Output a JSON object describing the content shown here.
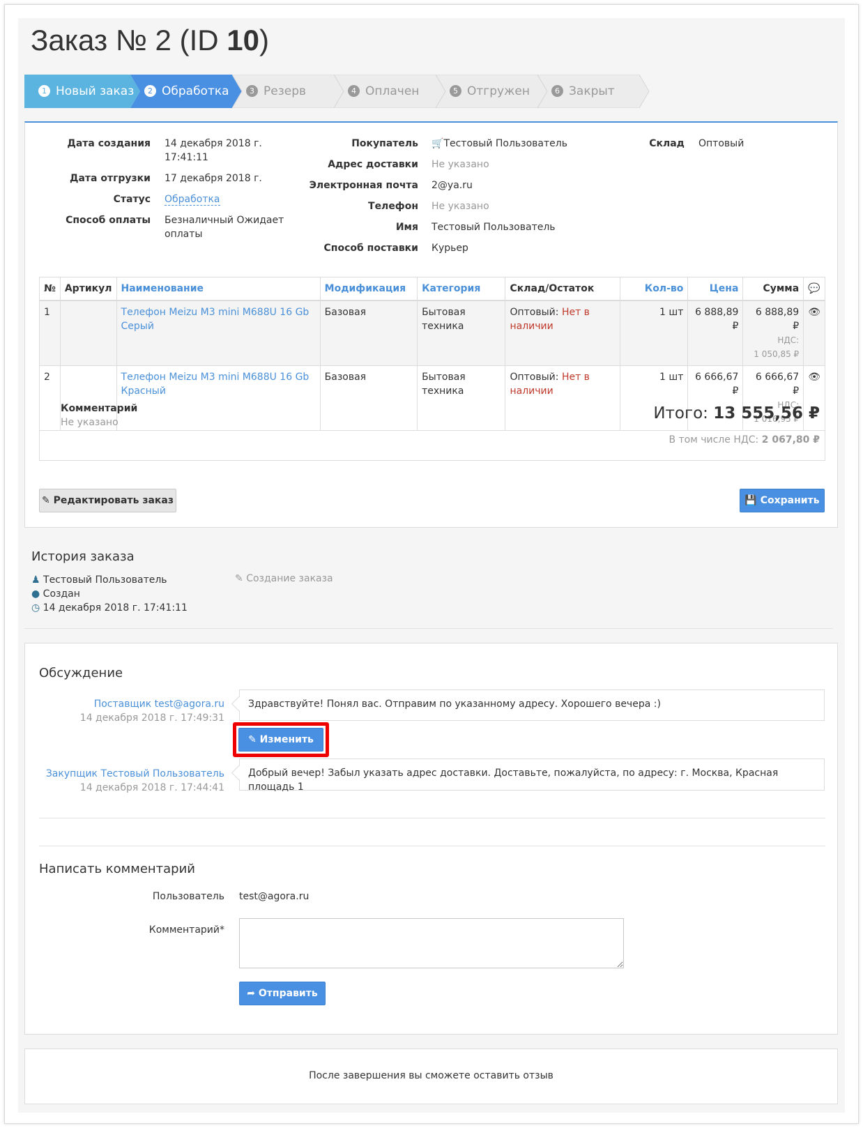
{
  "page_title": {
    "prefix": "Заказ № 2 (ID ",
    "id": "10",
    "suffix": ")"
  },
  "steps": [
    {
      "num": "1",
      "label": "Новый заказ"
    },
    {
      "num": "2",
      "label": "Обработка"
    },
    {
      "num": "3",
      "label": "Резерв"
    },
    {
      "num": "4",
      "label": "Оплачен"
    },
    {
      "num": "5",
      "label": "Отгружен"
    },
    {
      "num": "6",
      "label": "Закрыт"
    }
  ],
  "colors": {
    "step_done": "#5bb4e0",
    "step_active": "#4a90e2",
    "step_pending": "#ececec",
    "link": "#4a90d9",
    "danger": "#c0392b",
    "highlight": "#ee0000"
  },
  "order": {
    "created_label": "Дата создания",
    "created_date": "14 декабря 2018 г.",
    "created_time": "17:41:11",
    "shipped_label": "Дата отгрузки",
    "shipped_value": "17 декабря 2018 г.",
    "status_label": "Статус",
    "status_value": "Обработка",
    "payment_label": "Способ оплаты",
    "payment_value": "Безналичный Ожидает",
    "payment_value2": "оплаты",
    "buyer_label": "Покупатель",
    "buyer_value": "Тестовый Пользователь",
    "address_label": "Адрес доставки",
    "address_value": "Не указано",
    "email_label": "Электронная почта",
    "email_value": "2@ya.ru",
    "phone_label": "Телефон",
    "phone_value": "Не указано",
    "name_label": "Имя",
    "name_value": "Тестовый Пользователь",
    "delivery_label": "Способ поставки",
    "delivery_value": "Курьер",
    "warehouse_label": "Склад",
    "warehouse_value": "Оптовый"
  },
  "table": {
    "headers": {
      "num": "№",
      "article": "Артикул",
      "name": "Наименование",
      "mod": "Модификация",
      "cat": "Категория",
      "stock": "Склад/Остаток",
      "qty": "Кол-во",
      "price": "Цена",
      "sum": "Сумма"
    },
    "rows": [
      {
        "num": "1",
        "name": "Телефон Meizu M3 mini M688U 16 Gb Серый",
        "mod": "Базовая",
        "cat": "Бытовая техника",
        "stock_wh": "Оптовый:",
        "stock_state": "Нет в наличии",
        "qty": "1 шт",
        "price": "6 888,89 ₽",
        "sum": "6 888,89 ₽",
        "vat_label": "НДС:",
        "vat": "1 050,85 ₽"
      },
      {
        "num": "2",
        "name": "Телефон Meizu M3 mini M688U 16 Gb Красный",
        "mod": "Базовая",
        "cat": "Бытовая техника",
        "stock_wh": "Оптовый:",
        "stock_state": "Нет в наличии",
        "qty": "1 шт",
        "price": "6 666,67 ₽",
        "sum": "6 666,67 ₽",
        "vat_label": "НДС:",
        "vat": "1 016,95 ₽"
      }
    ],
    "comment_label": "Комментарий",
    "comment_value": "Не указано",
    "total_label": "Итого:",
    "total_value": "13 555,56 ₽",
    "vat_total_label": "В том числе НДС:",
    "vat_total_value": "2 067,80 ₽"
  },
  "buttons": {
    "edit_order": "Редактировать заказ",
    "save": "Сохранить",
    "change": "Изменить",
    "send": "Отправить"
  },
  "history": {
    "title": "История заказа",
    "user": "Тестовый Пользователь",
    "event": "Создан",
    "time": "14 декабря 2018 г. 17:41:11",
    "action": "Создание заказа"
  },
  "discussion": {
    "title": "Обсуждение",
    "messages": [
      {
        "author": "Поставщик test@agora.ru",
        "time": "14 декабря 2018 г. 17:49:31",
        "text": "Здравствуйте! Понял вас. Отправим по указанному адресу. Хорошего вечера :)"
      },
      {
        "author": "Закупщик Тестовый Пользователь",
        "time": "14 декабря 2018 г. 17:44:41",
        "text": "Добрый вечер! Забыл указать адрес доставки. Доставьте, пожалуйста, по адресу: г. Москва, Красная площадь 1"
      }
    ]
  },
  "comment_form": {
    "title": "Написать комментарий",
    "user_label": "Пользователь",
    "user_value": "test@agora.ru",
    "comment_label": "Комментарий*"
  },
  "footer": {
    "note": "После завершения вы сможете оставить отзыв"
  }
}
